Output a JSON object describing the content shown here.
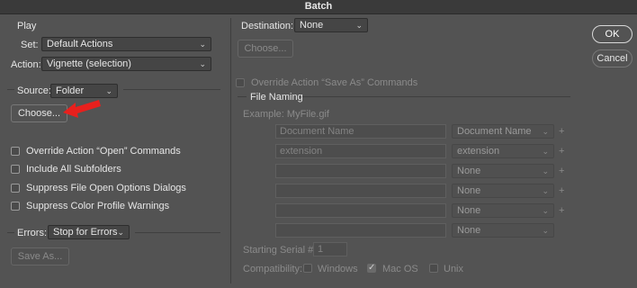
{
  "window": {
    "title": "Batch"
  },
  "play": {
    "section_label": "Play",
    "set_label": "Set:",
    "set_value": "Default Actions",
    "action_label": "Action:",
    "action_value": "Vignette (selection)"
  },
  "source": {
    "label": "Source:",
    "value": "Folder",
    "choose_button": "Choose...",
    "checkboxes": [
      {
        "label": "Override Action “Open” Commands",
        "checked": false
      },
      {
        "label": "Include All Subfolders",
        "checked": false
      },
      {
        "label": "Suppress File Open Options Dialogs",
        "checked": false
      },
      {
        "label": "Suppress Color Profile Warnings",
        "checked": false
      }
    ]
  },
  "errors": {
    "label": "Errors:",
    "value": "Stop for Errors",
    "save_as_button": "Save As..."
  },
  "destination": {
    "label": "Destination:",
    "value": "None",
    "choose_button": "Choose...",
    "override_label": "Override Action “Save As” Commands"
  },
  "file_naming": {
    "section_label": "File Naming",
    "example": "Example: MyFile.gif",
    "rows": [
      {
        "field": "Document Name",
        "select": "Document Name"
      },
      {
        "field": "extension",
        "select": "extension"
      },
      {
        "field": "",
        "select": "None"
      },
      {
        "field": "",
        "select": "None"
      },
      {
        "field": "",
        "select": "None"
      },
      {
        "field": "",
        "select": "None"
      }
    ],
    "plus_glyph": "+",
    "starting_serial_label": "Starting Serial #:",
    "starting_serial_value": "1",
    "compatibility_label": "Compatibility:",
    "compat": [
      {
        "label": "Windows",
        "checked": false
      },
      {
        "label": "Mac OS",
        "checked": true
      },
      {
        "label": "Unix",
        "checked": false
      }
    ]
  },
  "buttons": {
    "ok": "OK",
    "cancel": "Cancel"
  },
  "colors": {
    "background": "#535353",
    "titlebar": "#3a3a3a",
    "annotation_arrow": "#e8201d"
  },
  "icons": {
    "select_chevron": "chevron-down-icon",
    "checkmark": "checkmark-icon",
    "annotation": "red-arrow-icon"
  }
}
